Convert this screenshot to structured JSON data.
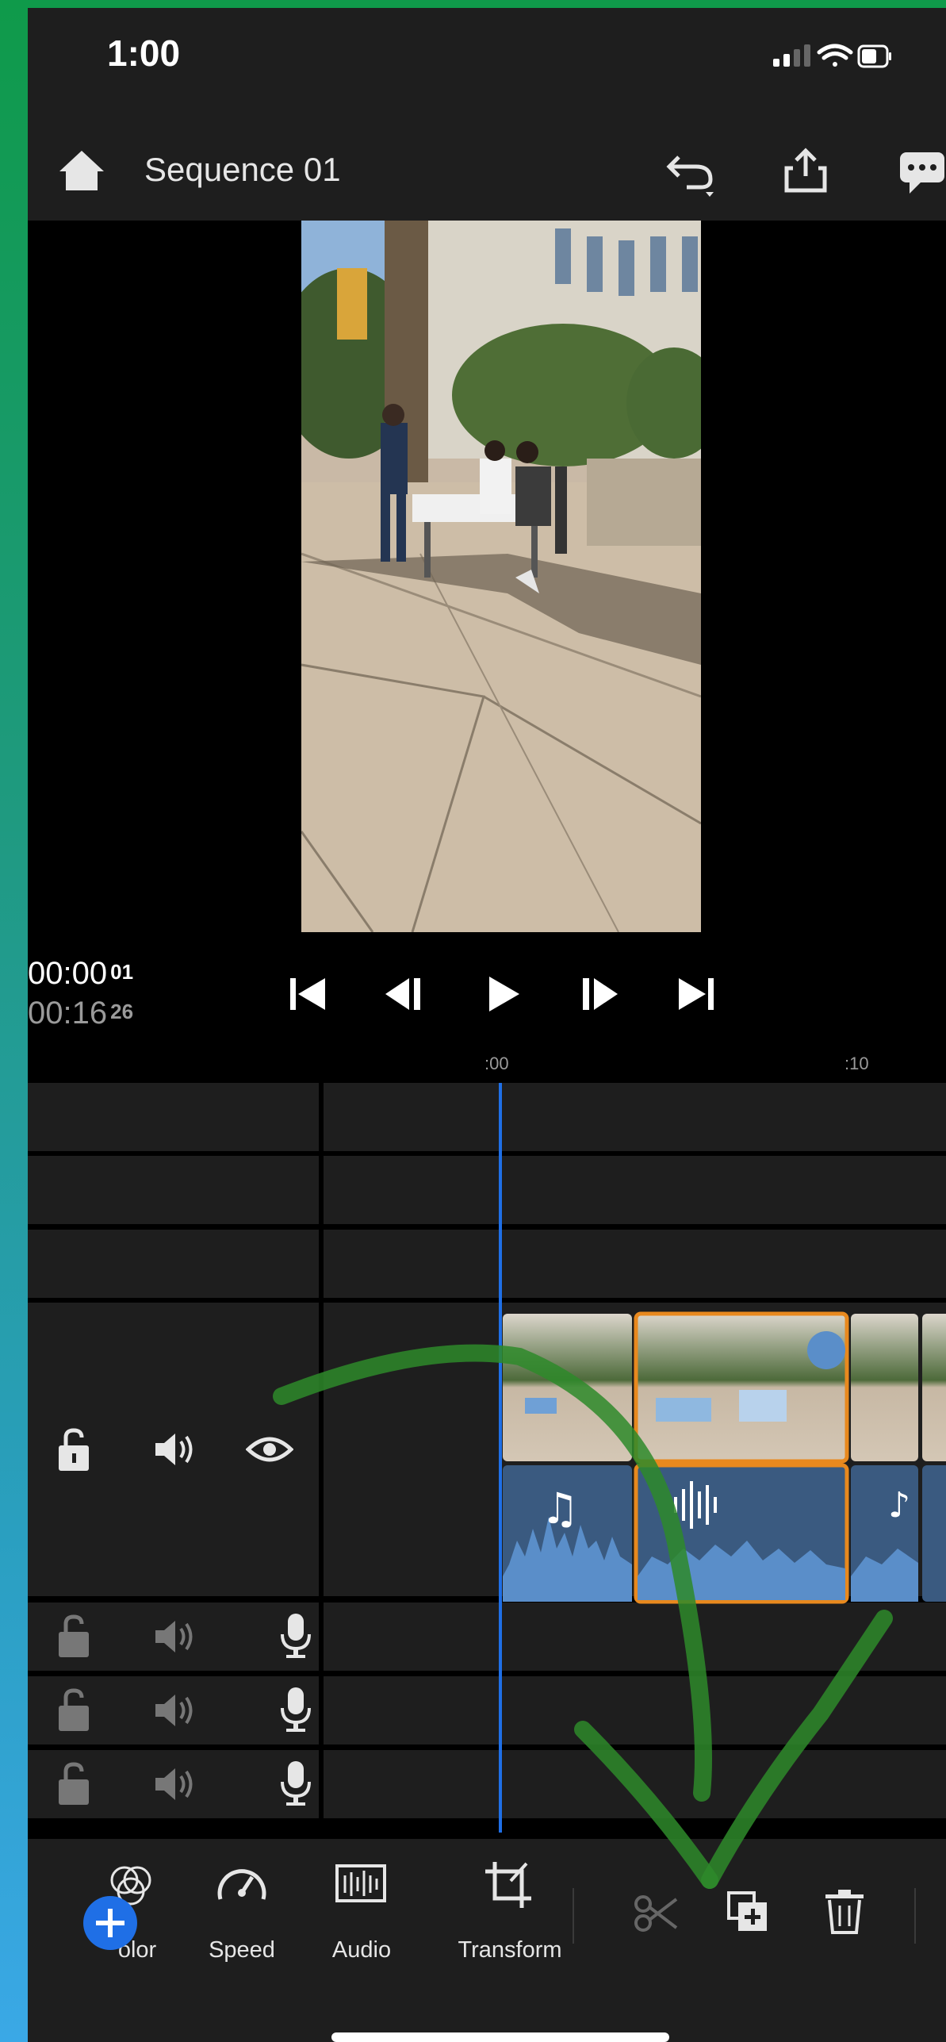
{
  "status_bar": {
    "time": "1:00"
  },
  "header": {
    "title": "Sequence 01"
  },
  "playback": {
    "current_time": "00:00",
    "current_frames": "01",
    "duration_time": "00:16",
    "duration_frames": "26"
  },
  "ruler": {
    "start_label": ":00",
    "mark_label": ":10"
  },
  "toolbar": {
    "color_label": "olor",
    "speed_label": "Speed",
    "audio_label": "Audio",
    "transform_label": "Transform"
  },
  "colors": {
    "accent_blue": "#1f6fe6",
    "selection_orange": "#e8891e",
    "audio_fill": "#5a8ec9",
    "annotation_green": "#2e8a2a"
  }
}
